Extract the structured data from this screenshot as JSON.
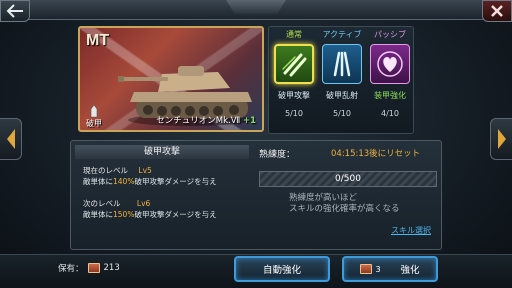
{
  "tank": {
    "class": "MT",
    "name": "センチュリオンMk.Ⅶ",
    "plus": "+1",
    "ammo_type": "破甲"
  },
  "skills": [
    {
      "category": "通常",
      "name": "破甲攻撃",
      "level": "5/10",
      "icon": "double-slash-icon"
    },
    {
      "category": "アクティブ",
      "name": "破甲乱射",
      "level": "5/10",
      "icon": "triple-beam-icon"
    },
    {
      "category": "パッシブ",
      "name": "装甲強化",
      "level": "4/10",
      "icon": "heart-icon"
    }
  ],
  "detail": {
    "skill_title": "破甲攻撃",
    "current_label": "現在のレベル",
    "current_level": "Lv5",
    "current_desc_pre": "敵単体に",
    "current_pct": "140%",
    "current_desc_post": "破甲攻撃ダメージを与え",
    "next_label": "次のレベル",
    "next_level": "Lv6",
    "next_desc_pre": "敵単体に",
    "next_pct": "150%",
    "next_desc_post": "破甲攻撃ダメージを与え"
  },
  "proficiency": {
    "label": "熟練度：",
    "reset_text": "04:15:13後にリセット",
    "value_text": "0/500",
    "fill_fraction": 0,
    "desc_line1": "熟練度が高いほど",
    "desc_line2": "スキルの強化確率が高くなる",
    "link": "スキル選択"
  },
  "bottom": {
    "owned_label": "保有：",
    "owned_count": "213",
    "auto_button": "自動強化",
    "enhance_count": "3",
    "enhance_button": "強化"
  },
  "colors": {
    "accent": "#3e9ad8",
    "highlight": "#f0b23c"
  }
}
